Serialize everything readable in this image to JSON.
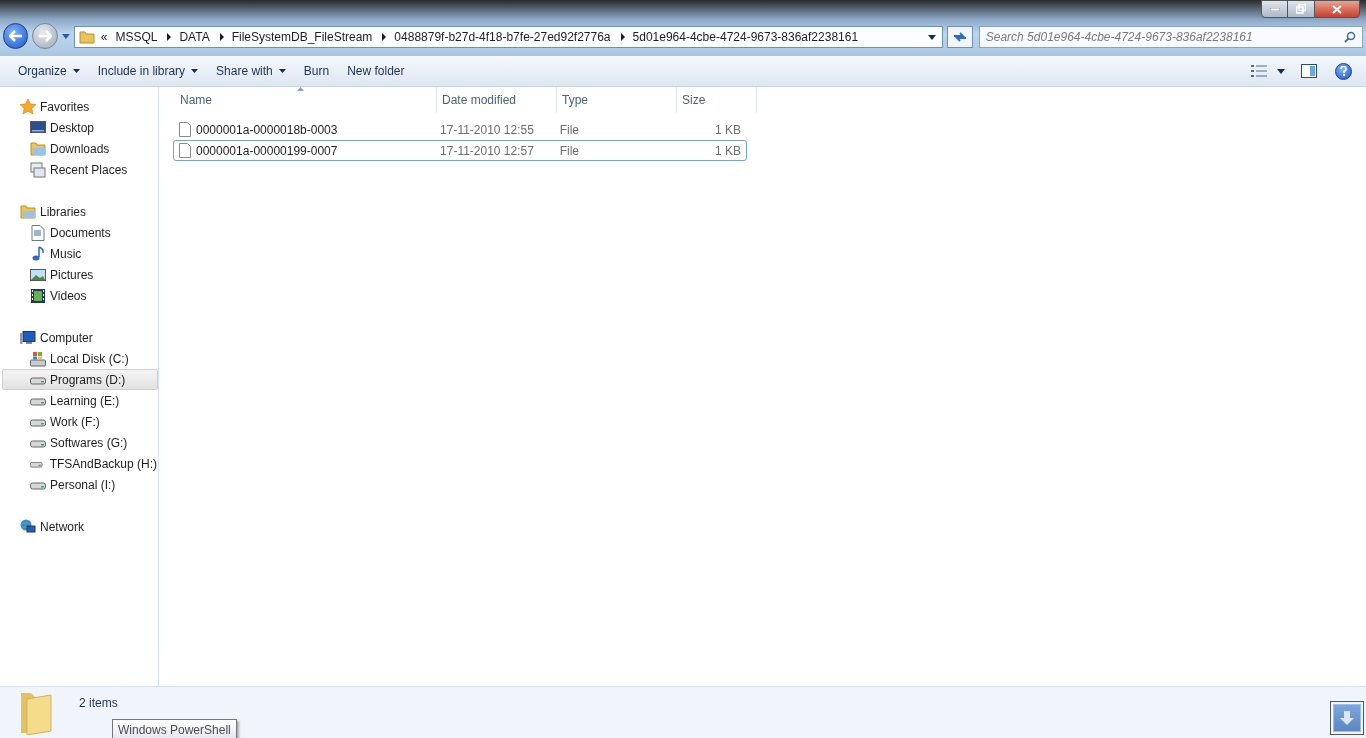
{
  "address": {
    "overflow": "«",
    "crumbs": [
      "MSSQL",
      "DATA",
      "FileSystemDB_FileStream",
      "0488879f-b27d-4f18-b7fe-27ed92f2776a",
      "5d01e964-4cbe-4724-9673-836af2238161"
    ]
  },
  "search": {
    "placeholder": "Search 5d01e964-4cbe-4724-9673-836af2238161"
  },
  "toolbar": [
    {
      "label": "Organize",
      "dropdown": true
    },
    {
      "label": "Include in library",
      "dropdown": true
    },
    {
      "label": "Share with",
      "dropdown": true
    },
    {
      "label": "Burn",
      "dropdown": false
    },
    {
      "label": "New folder",
      "dropdown": false
    }
  ],
  "sidebar": [
    {
      "label": "Favorites",
      "kind": "star",
      "selected": false,
      "children": [
        {
          "label": "Desktop",
          "kind": "desktop",
          "selected": false
        },
        {
          "label": "Downloads",
          "kind": "folder",
          "selected": false
        },
        {
          "label": "Recent Places",
          "kind": "recent",
          "selected": false
        }
      ]
    },
    {
      "label": "Libraries",
      "kind": "folder",
      "selected": false,
      "children": [
        {
          "label": "Documents",
          "kind": "document",
          "selected": false
        },
        {
          "label": "Music",
          "kind": "music",
          "selected": false
        },
        {
          "label": "Pictures",
          "kind": "picture",
          "selected": false
        },
        {
          "label": "Videos",
          "kind": "video",
          "selected": false
        }
      ]
    },
    {
      "label": "Computer",
      "kind": "computer",
      "selected": false,
      "children": [
        {
          "label": "Local Disk (C:)",
          "kind": "systemdisk",
          "selected": false
        },
        {
          "label": "Programs (D:)",
          "kind": "disk",
          "selected": true
        },
        {
          "label": "Learning (E:)",
          "kind": "disk",
          "selected": false
        },
        {
          "label": "Work (F:)",
          "kind": "disk",
          "selected": false
        },
        {
          "label": "Softwares (G:)",
          "kind": "disk",
          "selected": false
        },
        {
          "label": " TFSAndBackup (H:)",
          "kind": "disk",
          "selected": false
        },
        {
          "label": "Personal (I:)",
          "kind": "disk",
          "selected": false
        }
      ]
    },
    {
      "label": "Network",
      "kind": "network",
      "selected": false
    }
  ],
  "table": {
    "columns": [
      "Name",
      "Date modified",
      "Type",
      "Size"
    ],
    "rows": [
      {
        "name": "0000001a-0000018b-0003",
        "date": "17-11-2010 12:55",
        "type": "File",
        "size": "1 KB",
        "selected": false
      },
      {
        "name": "0000001a-00000199-0007",
        "date": "17-11-2010 12:57",
        "type": "File",
        "size": "1 KB",
        "selected": true
      }
    ]
  },
  "status_bar": {
    "count": "2 items"
  },
  "tooltip": "Windows PowerShell"
}
